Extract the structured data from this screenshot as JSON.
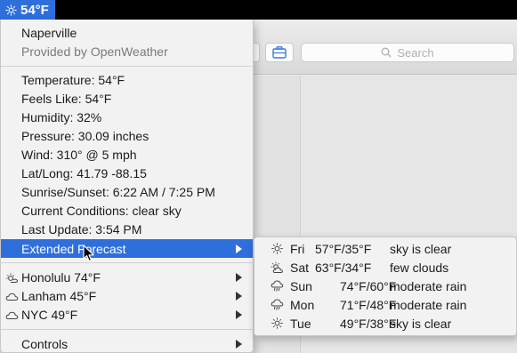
{
  "menubar": {
    "weather_item": "54°F",
    "weather_icon": "sun-icon"
  },
  "toolbar": {
    "search_placeholder": "Search"
  },
  "menu": {
    "location": "Naperville",
    "provider": "Provided by OpenWeather",
    "details": [
      "Temperature: 54°F",
      "Feels Like: 54°F",
      "Humidity: 32%",
      "Pressure: 30.09 inches",
      "Wind: 310° @ 5 mph",
      "Lat/Long: 41.79 -88.15",
      "Sunrise/Sunset: 6:22 AM / 7:25 PM",
      "Current Conditions: clear sky",
      "Last Update: 3:54 PM"
    ],
    "extended_forecast": "Extended Forecast",
    "locations": [
      {
        "label": "Honolulu 74°F",
        "icon": "sun-icon"
      },
      {
        "label": "Lanham 45°F",
        "icon": "cloud-icon"
      },
      {
        "label": "NYC 49°F",
        "icon": "cloud-icon"
      }
    ],
    "controls": "Controls"
  },
  "forecast": [
    {
      "day": "Fri",
      "temps": "57°F/35°F",
      "condition": "sky is clear",
      "icon": "sun-icon"
    },
    {
      "day": "Sat",
      "temps": "63°F/34°F",
      "condition": "few clouds",
      "icon": "partly-cloudy-icon"
    },
    {
      "day": "Sun",
      "temps": "74°F/60°F",
      "condition": "moderate rain",
      "icon": "rain-icon"
    },
    {
      "day": "Mon",
      "temps": "71°F/48°F",
      "condition": "moderate rain",
      "icon": "rain-icon"
    },
    {
      "day": "Tue",
      "temps": "49°F/38°F",
      "condition": "sky is clear",
      "icon": "sun-icon"
    }
  ],
  "colors": {
    "highlight": "#2f6fdc",
    "menu_bg": "#f2f2f2",
    "menubar_bg": "#000000"
  }
}
